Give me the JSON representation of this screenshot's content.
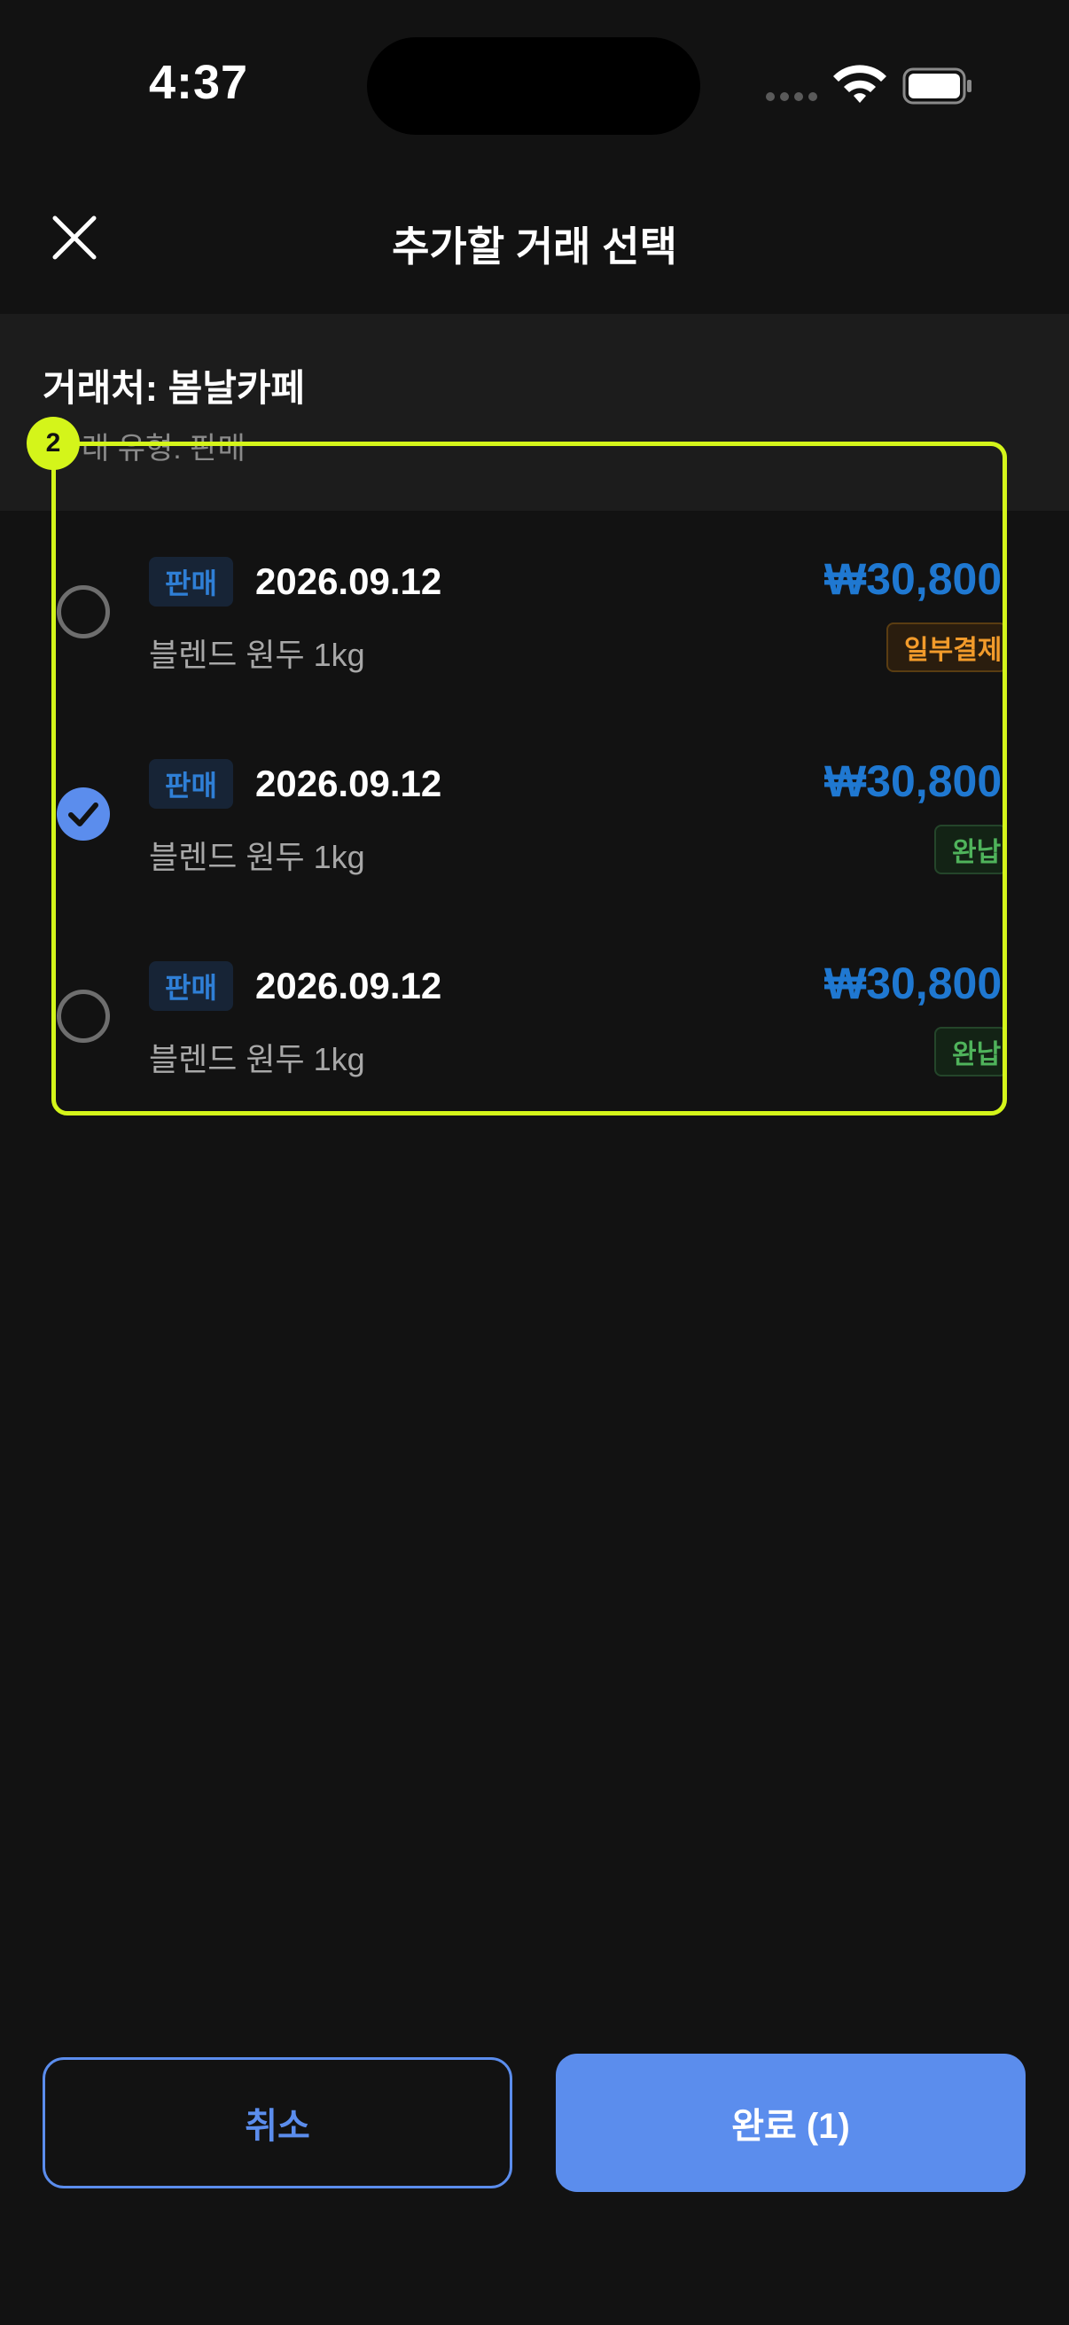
{
  "status_bar": {
    "time": "4:37"
  },
  "header": {
    "title": "추가할 거래 선택"
  },
  "info": {
    "vendor": "거래처: 봄날카페",
    "deal_type": "래 유형: 판매"
  },
  "annotation": {
    "label": "2"
  },
  "transactions": [
    {
      "tag": "판매",
      "date": "2026.09.12",
      "item": "블렌드 원두 1kg",
      "amount": "₩30,800",
      "status": "일부결제",
      "selected": false
    },
    {
      "tag": "판매",
      "date": "2026.09.12",
      "item": "블렌드 원두 1kg",
      "amount": "₩30,800",
      "status": "완납",
      "selected": true
    },
    {
      "tag": "판매",
      "date": "2026.09.12",
      "item": "블렌드 원두 1kg",
      "amount": "₩30,800",
      "status": "완납",
      "selected": false
    }
  ],
  "footer": {
    "cancel_label": "취소",
    "done_label": "완료 (1)"
  },
  "colors": {
    "accent": "#5b8ded",
    "amount": "#1f78d1",
    "partial": "#f29b2b",
    "done": "#4fb35b",
    "annotation": "#d4f51a"
  }
}
